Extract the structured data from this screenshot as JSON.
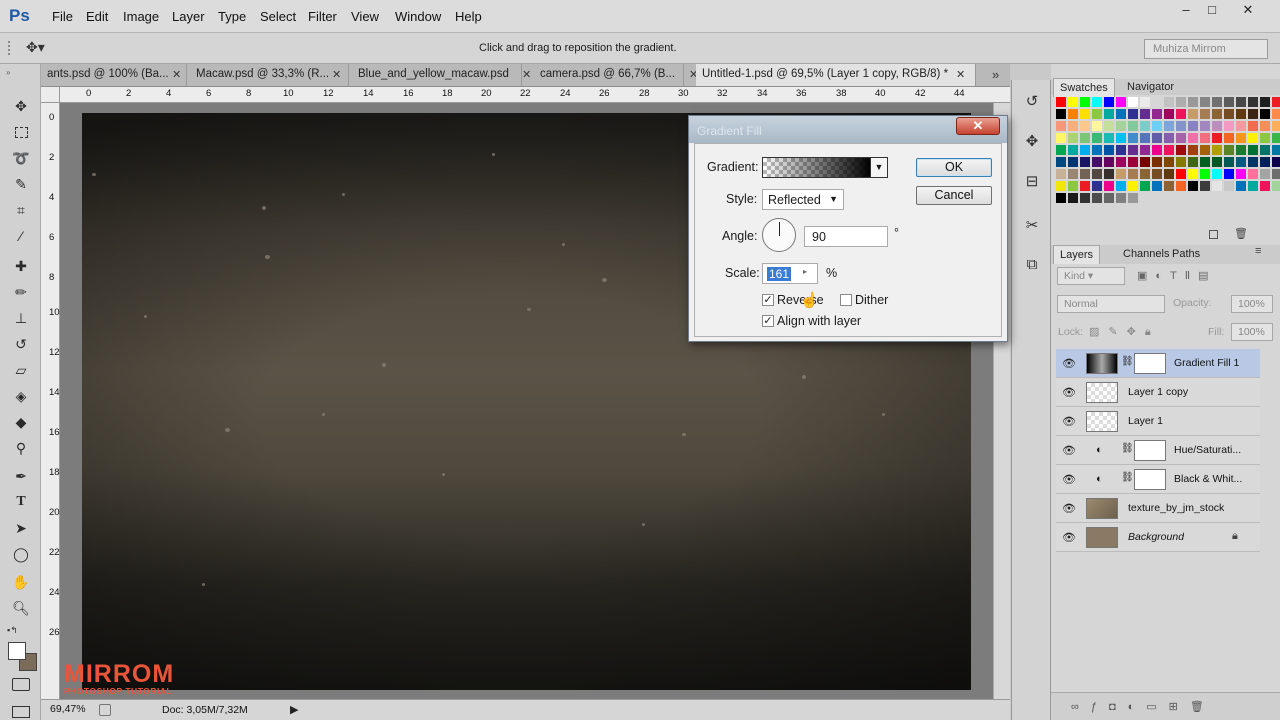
{
  "app": {
    "logo": "Ps"
  },
  "menu": [
    "File",
    "Edit",
    "Image",
    "Layer",
    "Type",
    "Select",
    "Filter",
    "View",
    "Window",
    "Help"
  ],
  "window_controls": {
    "minimize": "–",
    "maximize": "□",
    "close": "✕"
  },
  "options_bar": {
    "hint": "Click and drag to reposition the gradient.",
    "workspace": "Muhiza Mirrom"
  },
  "doc_tabs": [
    {
      "label": "ants.psd @ 100% (Ba..."
    },
    {
      "label": "Macaw.psd @ 33,3% (R..."
    },
    {
      "label": "Blue_and_yellow_macaw.psd"
    },
    {
      "label": "camera.psd @ 66,7% (B..."
    },
    {
      "label": "Untitled-1.psd @ 69,5% (Layer 1 copy, RGB/8) *"
    }
  ],
  "ruler_top": [
    "0",
    "2",
    "4",
    "6",
    "8",
    "10",
    "12",
    "14",
    "16",
    "18",
    "20",
    "22",
    "24",
    "26",
    "28",
    "30",
    "32",
    "34",
    "36",
    "38",
    "40",
    "42",
    "44"
  ],
  "ruler_left": [
    "0",
    "2",
    "4",
    "6",
    "8",
    "10",
    "12",
    "14",
    "16",
    "18",
    "20",
    "22",
    "24",
    "26"
  ],
  "status": {
    "zoom": "69,47%",
    "doc": "Doc: 3,05M/7,32M"
  },
  "watermark": {
    "title": "MIRROM",
    "subtitle": "PHOTOSHOP TUTORIAL"
  },
  "swatches_panel": {
    "tabs": [
      "Swatches",
      "Navigator"
    ]
  },
  "layers_panel": {
    "tabs": [
      "Layers",
      "Channels",
      "Paths"
    ],
    "kind": "Kind",
    "blend_mode": "Normal",
    "opacity_label": "Opacity:",
    "opacity": "100%",
    "lock_label": "Lock:",
    "fill_label": "Fill:",
    "fill": "100%",
    "layers": [
      {
        "name": "Gradient Fill 1",
        "selected": true
      },
      {
        "name": "Layer 1 copy"
      },
      {
        "name": "Layer 1"
      },
      {
        "name": "Hue/Saturati..."
      },
      {
        "name": "Black & Whit..."
      },
      {
        "name": "texture_by_jm_stock"
      },
      {
        "name": "Background"
      }
    ]
  },
  "dialog": {
    "title": "Gradient Fill",
    "close": "✕",
    "gradient_label": "Gradient:",
    "style_label": "Style:",
    "style_value": "Reflected",
    "angle_label": "Angle:",
    "angle_value": "90",
    "degree": "°",
    "scale_label": "Scale:",
    "scale_value": "161",
    "percent": "%",
    "reverse_label": "Reverse",
    "reverse_checked": true,
    "dither_label": "Dither",
    "dither_checked": false,
    "align_label": "Align with layer",
    "align_checked": true,
    "ok": "OK",
    "cancel": "Cancel"
  }
}
